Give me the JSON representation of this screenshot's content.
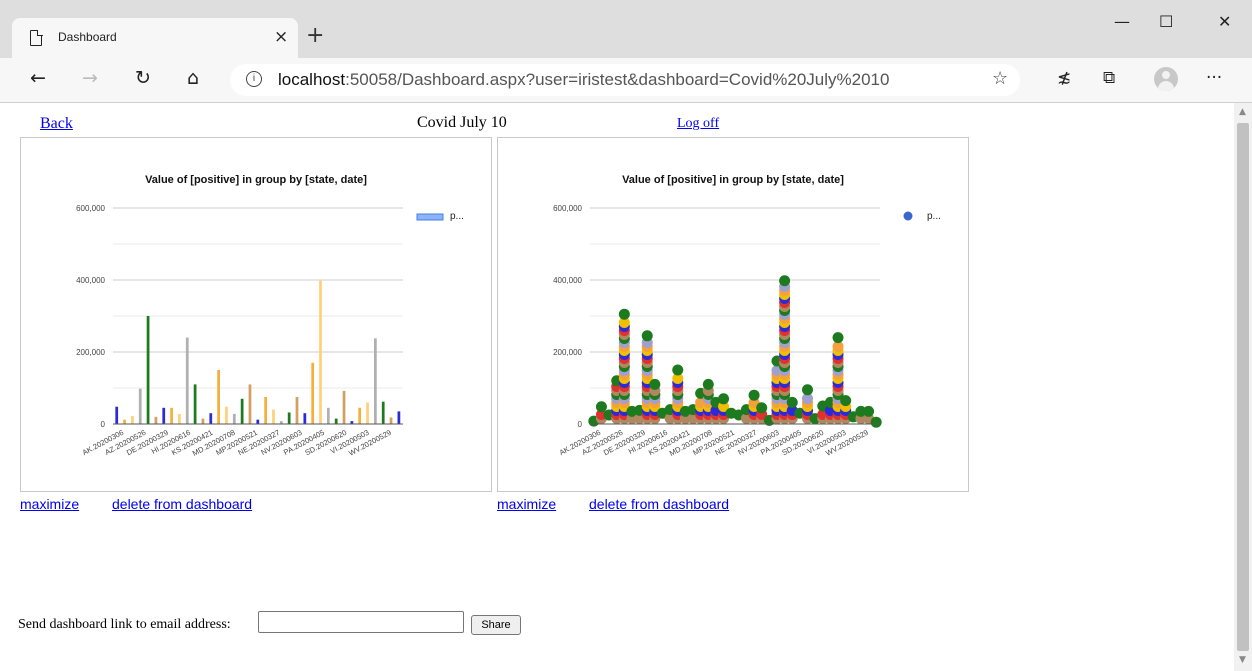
{
  "browser": {
    "tab_title": "Dashboard",
    "tab_close": "×",
    "new_tab": "+",
    "window": {
      "minimize": "—",
      "maximize": "☐",
      "close": "✕"
    },
    "nav": {
      "back": "←",
      "forward": "→",
      "refresh": "↻",
      "home": "⌂"
    },
    "address": {
      "info": "i",
      "host": "localhost",
      "rest": ":50058/Dashboard.aspx?user=iristest&dashboard=Covid%20July%2010"
    },
    "favorite": "☆",
    "favorites_list": "≴",
    "collections": "⧉",
    "more": "···",
    "scroll_up": "▲",
    "scroll_down": "▼"
  },
  "page": {
    "back_link": "Back",
    "dashboard_title": "Covid July 10",
    "logoff_link": "Log off",
    "panels": [
      {
        "maximize": "maximize",
        "delete": "delete from dashboard"
      },
      {
        "maximize": "maximize",
        "delete": "delete from dashboard"
      }
    ],
    "share": {
      "label": "Send dashboard link to email address:",
      "email_value": "",
      "button": "Share"
    }
  },
  "chart_data": [
    {
      "type": "bar",
      "title": "Value of [positive] in group by [state, date]",
      "legend": [
        "p..."
      ],
      "legend_position": "right",
      "ylim": [
        0,
        600000
      ],
      "y_ticks": [
        "0",
        "200,000",
        "400,000",
        "600,000"
      ],
      "x_tick_labels": [
        "AK.20200306",
        "AZ.20200526",
        "DE.20200329",
        "HI.20200616",
        "KS.20200421",
        "MD.20200708",
        "MP.20200521",
        "NE.20200327",
        "NV.20200603",
        "PA.20200405",
        "SD.20200620",
        "VI.20200503",
        "WV.20200529"
      ],
      "series": [
        {
          "values": [
            48000,
            12000,
            22000,
            98000,
            300000,
            20000,
            45000,
            45000,
            28000,
            240000,
            110000,
            15000,
            30000,
            150000,
            48000,
            28000,
            70000,
            110000,
            12000,
            75000,
            40000,
            8000,
            32000,
            75000,
            30000,
            170000,
            398000,
            45000,
            15000,
            92000,
            8000,
            45000,
            60000,
            238000,
            62000,
            18000,
            35000
          ]
        }
      ],
      "colors": [
        "#2a2ad8",
        "#f4b03c",
        "#ffd07a",
        "#b0b0b0",
        "#1e7a1e",
        "#d4a060"
      ],
      "grid": true
    },
    {
      "type": "scatter",
      "title": "Value of [positive] in group by [state, date]",
      "legend": [
        "p..."
      ],
      "legend_position": "right",
      "ylim": [
        0,
        600000
      ],
      "y_ticks": [
        "0",
        "200,000",
        "400,000",
        "600,000"
      ],
      "x_tick_labels": [
        "AK.20200306",
        "AZ.20200526",
        "DE.20200329",
        "HI.20200616",
        "KS.20200421",
        "MD.20200708",
        "MP.20200521",
        "NE.20200327",
        "NV.20200603",
        "PA.20200405",
        "SD.20200620",
        "VI.20200503",
        "WV.20200529"
      ],
      "series": [
        {
          "values": [
            8000,
            48000,
            25000,
            120000,
            305000,
            35000,
            38000,
            245000,
            110000,
            30000,
            40000,
            150000,
            35000,
            40000,
            85000,
            110000,
            60000,
            70000,
            30000,
            25000,
            40000,
            80000,
            45000,
            10000,
            175000,
            398000,
            60000,
            30000,
            95000,
            15000,
            50000,
            60000,
            240000,
            65000,
            20000,
            35000,
            35000,
            5000
          ]
        }
      ],
      "colors": [
        "#1e7a1e",
        "#b08860",
        "#e03030",
        "#2a2ad8",
        "#f0c000",
        "#f4a03c",
        "#a0a0d0"
      ],
      "grid": true
    }
  ]
}
